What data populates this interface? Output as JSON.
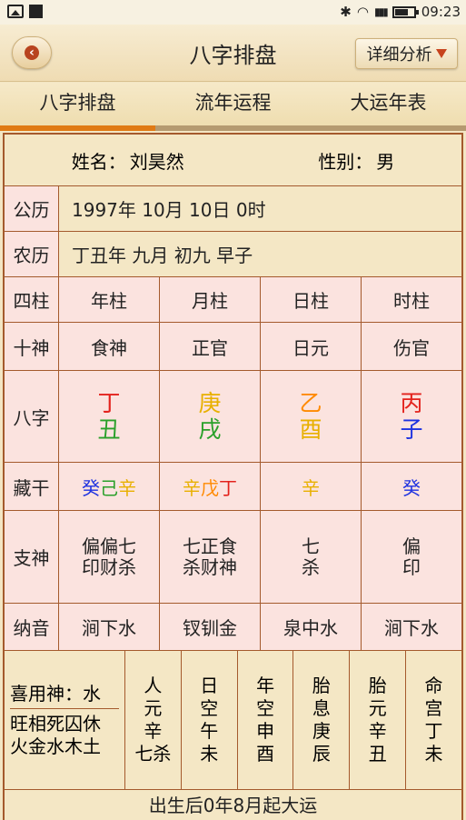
{
  "status": {
    "time": "09:23"
  },
  "header": {
    "title": "八字排盘",
    "detail_label": "详细分析"
  },
  "tabs": [
    "八字排盘",
    "流年运程",
    "大运年表"
  ],
  "profile": {
    "name_label": "姓名：",
    "name": "刘昊然",
    "gender_label": "性别：",
    "gender": "男"
  },
  "solar": {
    "label": "公历",
    "value": "1997年 10月 10日 0时"
  },
  "lunar": {
    "label": "农历",
    "value": "丁丑年 九月 初九 早子"
  },
  "pillars": {
    "label": "四柱",
    "cols": [
      "年柱",
      "月柱",
      "日柱",
      "时柱"
    ]
  },
  "shishen": {
    "label": "十神",
    "cols": [
      "食神",
      "正官",
      "日元",
      "伤官"
    ]
  },
  "bazi": {
    "label": "八字",
    "stems": [
      "丁",
      "庚",
      "乙",
      "丙"
    ],
    "branches": [
      "丑",
      "戌",
      "酉",
      "子"
    ]
  },
  "canggan": {
    "label": "藏干",
    "cols": [
      [
        "癸",
        "己",
        "辛"
      ],
      [
        "辛",
        "戊",
        "丁"
      ],
      [
        "辛"
      ],
      [
        "癸"
      ]
    ]
  },
  "zhishen": {
    "label": "支神",
    "cols": [
      [
        "偏偏七",
        "印财杀"
      ],
      [
        "七正食",
        "杀财神"
      ],
      [
        "七",
        "杀"
      ],
      [
        "偏",
        "印"
      ]
    ]
  },
  "nayin": {
    "label": "纳音",
    "cols": [
      "涧下水",
      "钗钏金",
      "泉中水",
      "涧下水"
    ]
  },
  "xiyong": {
    "line1": "喜用神：水",
    "line2": "旺相死囚休",
    "line3": "火金水木土"
  },
  "extra": [
    [
      "人",
      "元",
      "辛",
      "七杀"
    ],
    [
      "日",
      "空",
      "午",
      "未"
    ],
    [
      "年",
      "空",
      "申",
      "酉"
    ],
    [
      "胎",
      "息",
      "庚",
      "辰"
    ],
    [
      "胎",
      "元",
      "辛",
      "丑"
    ],
    [
      "命",
      "宫",
      "丁",
      "未"
    ]
  ],
  "footer": "出生后0年8月起大运",
  "colors": {
    "accent": "#e07a14",
    "border": "#a45a2d",
    "pink": "#fbe3df"
  }
}
